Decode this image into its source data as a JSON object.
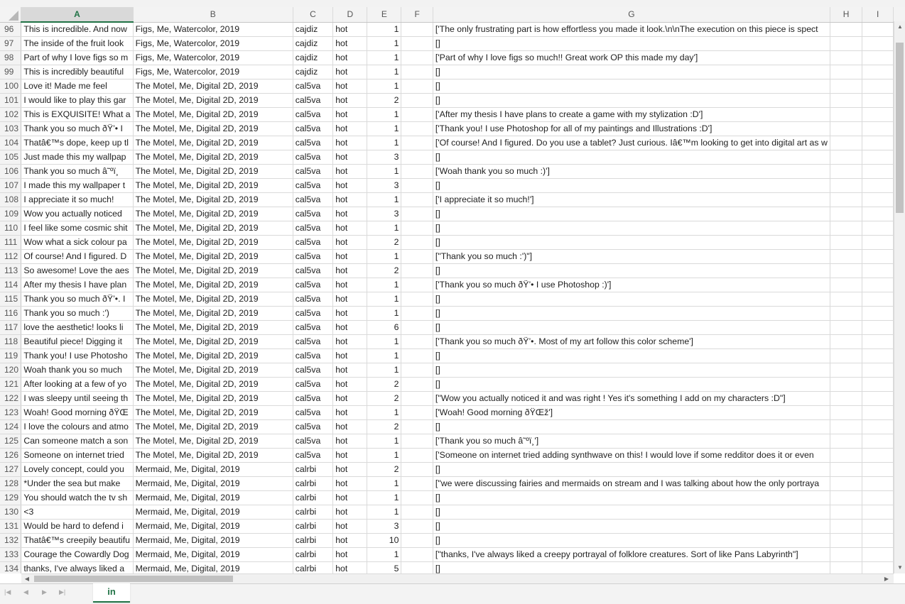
{
  "columns": [
    "A",
    "B",
    "C",
    "D",
    "E",
    "F",
    "G",
    "H",
    "I"
  ],
  "active_column": "A",
  "rows": [
    {
      "n": "96",
      "a": "This is incredible. And now",
      "b": "Figs, Me, Watercolor, 2019",
      "c": "cajdiz",
      "d": "hot",
      "e": "1",
      "g": "['The only frustrating part is how effortless you made it look.\\n\\nThe execution on this piece is spect"
    },
    {
      "n": "97",
      "a": "The inside of the fruit look",
      "b": "Figs, Me, Watercolor, 2019",
      "c": "cajdiz",
      "d": "hot",
      "e": "1",
      "g": "[]"
    },
    {
      "n": "98",
      "a": "Part of why I love figs so m",
      "b": "Figs, Me, Watercolor, 2019",
      "c": "cajdiz",
      "d": "hot",
      "e": "1",
      "g": "['Part of why I love figs so much!! Great work OP this made my day']"
    },
    {
      "n": "99",
      "a": "This is incredibly beautiful",
      "b": "Figs, Me, Watercolor, 2019",
      "c": "cajdiz",
      "d": "hot",
      "e": "1",
      "g": "[]"
    },
    {
      "n": "100",
      "a": "Love it! Made me feel",
      "b": "The Motel, Me, Digital 2D, 2019",
      "c": "cal5va",
      "d": "hot",
      "e": "1",
      "g": "[]"
    },
    {
      "n": "101",
      "a": "I would like to play this gar",
      "b": "The Motel, Me, Digital 2D, 2019",
      "c": "cal5va",
      "d": "hot",
      "e": "2",
      "g": "[]"
    },
    {
      "n": "102",
      "a": "This is EXQUISITE! What a",
      "b": "The Motel, Me, Digital 2D, 2019",
      "c": "cal5va",
      "d": "hot",
      "e": "1",
      "g": "['After my thesis I have plans to create a game with my stylization :D']"
    },
    {
      "n": "103",
      "a": "Thank you so much ðŸ’• I",
      "b": "The Motel, Me, Digital 2D, 2019",
      "c": "cal5va",
      "d": "hot",
      "e": "1",
      "g": "['Thank you! I use Photoshop for all of my paintings and Illustrations :D']"
    },
    {
      "n": "104",
      "a": "Thatâ€™s dope, keep up tl",
      "b": "The Motel, Me, Digital 2D, 2019",
      "c": "cal5va",
      "d": "hot",
      "e": "1",
      "g": "['Of course! And I figured. Do you use a tablet? Just curious. Iâ€™m looking to get into digital art as w"
    },
    {
      "n": "105",
      "a": "Just made this my wallpap",
      "b": "The Motel, Me, Digital 2D, 2019",
      "c": "cal5va",
      "d": "hot",
      "e": "3",
      "g": "[]"
    },
    {
      "n": "106",
      "a": "Thank you so much â˜ºï¸",
      "b": "The Motel, Me, Digital 2D, 2019",
      "c": "cal5va",
      "d": "hot",
      "e": "1",
      "g": "['Woah thank you so much :)']"
    },
    {
      "n": "107",
      "a": "I made this my wallpaper t",
      "b": "The Motel, Me, Digital 2D, 2019",
      "c": "cal5va",
      "d": "hot",
      "e": "3",
      "g": "[]"
    },
    {
      "n": "108",
      "a": "I appreciate it so much!",
      "b": "The Motel, Me, Digital 2D, 2019",
      "c": "cal5va",
      "d": "hot",
      "e": "1",
      "g": "['I appreciate it so much!']"
    },
    {
      "n": "109",
      "a": "Wow you actually noticed",
      "b": "The Motel, Me, Digital 2D, 2019",
      "c": "cal5va",
      "d": "hot",
      "e": "3",
      "g": "[]"
    },
    {
      "n": "110",
      "a": "I feel like some cosmic shit",
      "b": "The Motel, Me, Digital 2D, 2019",
      "c": "cal5va",
      "d": "hot",
      "e": "1",
      "g": "[]"
    },
    {
      "n": "111",
      "a": "Wow what a sick colour pa",
      "b": "The Motel, Me, Digital 2D, 2019",
      "c": "cal5va",
      "d": "hot",
      "e": "2",
      "g": "[]"
    },
    {
      "n": "112",
      "a": "Of course! And I figured. D",
      "b": "The Motel, Me, Digital 2D, 2019",
      "c": "cal5va",
      "d": "hot",
      "e": "1",
      "g": "[\"Thank you so much :')\"]"
    },
    {
      "n": "113",
      "a": "So awesome! Love the aes",
      "b": "The Motel, Me, Digital 2D, 2019",
      "c": "cal5va",
      "d": "hot",
      "e": "2",
      "g": "[]"
    },
    {
      "n": "114",
      "a": "After my thesis I have plan",
      "b": "The Motel, Me, Digital 2D, 2019",
      "c": "cal5va",
      "d": "hot",
      "e": "1",
      "g": "['Thank you so much ðŸ’• I use Photoshop :)']"
    },
    {
      "n": "115",
      "a": "Thank you so much ðŸ’•. I",
      "b": "The Motel, Me, Digital 2D, 2019",
      "c": "cal5va",
      "d": "hot",
      "e": "1",
      "g": "[]"
    },
    {
      "n": "116",
      "a": "Thank you so much :')",
      "b": "The Motel, Me, Digital 2D, 2019",
      "c": "cal5va",
      "d": "hot",
      "e": "1",
      "g": "[]"
    },
    {
      "n": "117",
      "a": "love the aesthetic! looks li",
      "b": "The Motel, Me, Digital 2D, 2019",
      "c": "cal5va",
      "d": "hot",
      "e": "6",
      "g": "[]"
    },
    {
      "n": "118",
      "a": "Beautiful piece! Digging it",
      "b": "The Motel, Me, Digital 2D, 2019",
      "c": "cal5va",
      "d": "hot",
      "e": "1",
      "g": "['Thank you so much ðŸ’•. Most of my art follow this color scheme']"
    },
    {
      "n": "119",
      "a": "Thank you! I use Photosho",
      "b": "The Motel, Me, Digital 2D, 2019",
      "c": "cal5va",
      "d": "hot",
      "e": "1",
      "g": "[]"
    },
    {
      "n": "120",
      "a": "Woah thank you so much",
      "b": "The Motel, Me, Digital 2D, 2019",
      "c": "cal5va",
      "d": "hot",
      "e": "1",
      "g": "[]"
    },
    {
      "n": "121",
      "a": "After looking at a few of yo",
      "b": "The Motel, Me, Digital 2D, 2019",
      "c": "cal5va",
      "d": "hot",
      "e": "2",
      "g": "[]"
    },
    {
      "n": "122",
      "a": "I was sleepy until seeing th",
      "b": "The Motel, Me, Digital 2D, 2019",
      "c": "cal5va",
      "d": "hot",
      "e": "2",
      "g": "[\"Wow you actually noticed it and was right ! Yes it's something I add on my characters :D\"]"
    },
    {
      "n": "123",
      "a": "Woah! Good morning ðŸŒ",
      "b": "The Motel, Me, Digital 2D, 2019",
      "c": "cal5va",
      "d": "hot",
      "e": "1",
      "g": "['Woah! Good morning ðŸŒž']"
    },
    {
      "n": "124",
      "a": "I love the colours and atmo",
      "b": "The Motel, Me, Digital 2D, 2019",
      "c": "cal5va",
      "d": "hot",
      "e": "2",
      "g": "[]"
    },
    {
      "n": "125",
      "a": "Can someone match a son",
      "b": "The Motel, Me, Digital 2D, 2019",
      "c": "cal5va",
      "d": "hot",
      "e": "1",
      "g": "['Thank you so much â˜ºï¸']"
    },
    {
      "n": "126",
      "a": "Someone on internet tried",
      "b": "The Motel, Me, Digital 2D, 2019",
      "c": "cal5va",
      "d": "hot",
      "e": "1",
      "g": "['Someone on internet tried adding synthwave on this! I would love if some redditor does it or even"
    },
    {
      "n": "127",
      "a": "Lovely concept, could you",
      "b": "Mermaid, Me, Digital, 2019",
      "c": "calrbi",
      "d": "hot",
      "e": "2",
      "g": "[]"
    },
    {
      "n": "128",
      "a": "*Under the sea but make",
      "b": "Mermaid, Me, Digital, 2019",
      "c": "calrbi",
      "d": "hot",
      "e": "1",
      "g": "[\"we were discussing fairies and mermaids on stream and I was talking about how the only portraya"
    },
    {
      "n": "129",
      "a": "You should watch the tv sh",
      "b": "Mermaid, Me, Digital, 2019",
      "c": "calrbi",
      "d": "hot",
      "e": "1",
      "g": "[]"
    },
    {
      "n": "130",
      "a": "<3",
      "b": "Mermaid, Me, Digital, 2019",
      "c": "calrbi",
      "d": "hot",
      "e": "1",
      "g": "[]"
    },
    {
      "n": "131",
      "a": "Would be hard to defend i",
      "b": "Mermaid, Me, Digital, 2019",
      "c": "calrbi",
      "d": "hot",
      "e": "3",
      "g": "[]"
    },
    {
      "n": "132",
      "a": "Thatâ€™s creepily beautifu",
      "b": "Mermaid, Me, Digital, 2019",
      "c": "calrbi",
      "d": "hot",
      "e": "10",
      "g": "[]"
    },
    {
      "n": "133",
      "a": "Courage the Cowardly Dog",
      "b": "Mermaid, Me, Digital, 2019",
      "c": "calrbi",
      "d": "hot",
      "e": "1",
      "g": "[\"thanks, I've always liked a creepy portrayal of folklore creatures.  Sort of like Pans Labyrinth\"]"
    },
    {
      "n": "134",
      "a": "thanks, I've always liked a",
      "b": "Mermaid, Me, Digital, 2019",
      "c": "calrbi",
      "d": "hot",
      "e": "5",
      "g": "[]"
    }
  ],
  "sheet_tab": "in",
  "colors": {
    "accent": "#217346",
    "header_bg": "#f3f3f3",
    "grid_line": "#dadada"
  }
}
